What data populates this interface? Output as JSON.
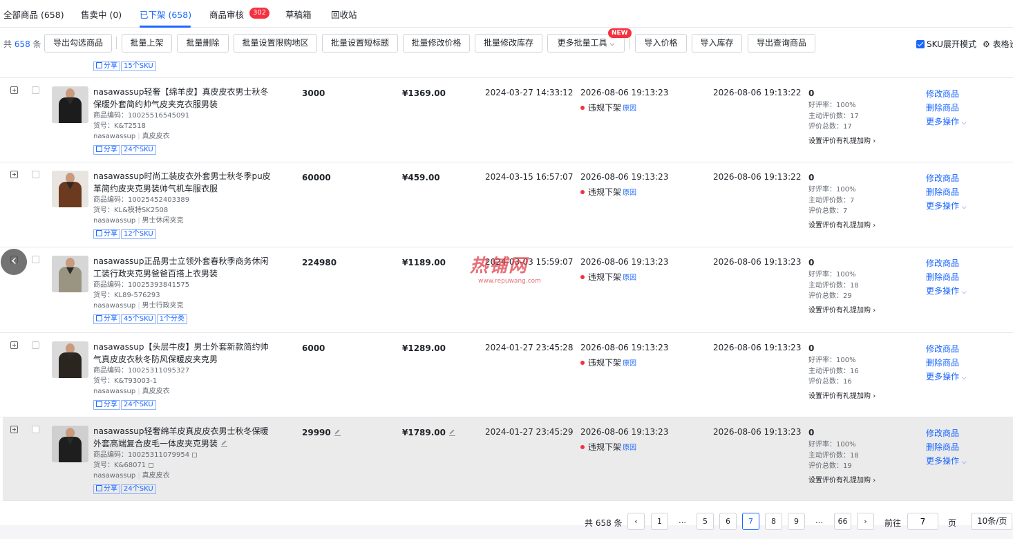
{
  "tabs": [
    {
      "label": "全部商品 (658)"
    },
    {
      "label": "售卖中 (0)"
    },
    {
      "label": "已下架 (658)"
    },
    {
      "label": "商品审核"
    },
    {
      "label": "草稿箱"
    },
    {
      "label": "回收站"
    }
  ],
  "audit_badge": "302",
  "toolbar": {
    "total_prefix": "共 ",
    "total_num": "658",
    "total_suffix": " 条",
    "buttons": [
      "导出勾选商品",
      "批量上架",
      "批量删除",
      "批量设置限购地区",
      "批量设置短标题",
      "批量修改价格",
      "批量修改库存",
      "更多批量工具",
      "导入价格",
      "导入库存",
      "导出查询商品"
    ],
    "new_badge": "NEW",
    "sku_mode": "SKU展开模式",
    "table_settings": "表格设置"
  },
  "top_partial": {
    "share": "分享",
    "sku": "15个SKU"
  },
  "rows": [
    {
      "title": "nasawassup轻奢【绵羊皮】真皮皮衣男士秋冬保暖外套简约帅气皮夹克衣服男装",
      "code": "商品编码：10025516545091",
      "sku_no": "货号：K&T2518",
      "shop": "nasawassup",
      "category": "真皮皮衣",
      "tags": [
        "分享",
        "24个SKU"
      ],
      "stock": "3000",
      "price": "¥1369.00",
      "created": "2024-03-27 14:33:12",
      "offshelf": "2026-08-06 19:13:23",
      "status": "违规下架",
      "reason": "原因",
      "updated": "2026-08-06 19:13:22",
      "review_count": "0",
      "good_rate": "好评率：100%",
      "active_reviews": "主动评价数：17",
      "total_reviews": "评价总数：17",
      "review_setting": "设置评价有礼提加购",
      "actions": [
        "修改商品",
        "删除商品",
        "更多操作"
      ]
    },
    {
      "title": "nasawassup时尚工装皮衣外套男士秋冬季pu皮革简约皮夹克男装帅气机车服衣服",
      "code": "商品编码：10025452403389",
      "sku_no": "货号：KL&模特SK2508",
      "shop": "nasawassup",
      "category": "男士休闲夹克",
      "tags": [
        "分享",
        "12个SKU"
      ],
      "stock": "60000",
      "price": "¥459.00",
      "created": "2024-03-15 16:57:07",
      "offshelf": "2026-08-06 19:13:23",
      "status": "违规下架",
      "reason": "原因",
      "updated": "2026-08-06 19:13:22",
      "review_count": "0",
      "good_rate": "好评率：100%",
      "active_reviews": "主动评价数：7",
      "total_reviews": "评价总数：7",
      "review_setting": "设置评价有礼提加购",
      "actions": [
        "修改商品",
        "删除商品",
        "更多操作"
      ]
    },
    {
      "title": "nasawassup正品男士立领外套春秋季商务休闲工装行政夹克男爸爸百搭上衣男装",
      "code": "商品编码：10025393841575",
      "sku_no": "货号：KL89-576293",
      "shop": "nasawassup",
      "category": "男士行政夹克",
      "tags": [
        "分享",
        "45个SKU",
        "1个分类"
      ],
      "stock": "224980",
      "price": "¥1189.00",
      "created": "2024-03-03 15:59:07",
      "offshelf": "2026-08-06 19:13:23",
      "status": "违规下架",
      "reason": "原因",
      "updated": "2026-08-06 19:13:23",
      "review_count": "0",
      "good_rate": "好评率：100%",
      "active_reviews": "主动评价数：18",
      "total_reviews": "评价总数：29",
      "review_setting": "设置评价有礼提加购",
      "actions": [
        "修改商品",
        "删除商品",
        "更多操作"
      ]
    },
    {
      "title": "nasawassup【头层牛皮】男士外套新款简约帅气真皮皮衣秋冬防风保暖皮夹克男",
      "code": "商品编码：10025311095327",
      "sku_no": "货号：K&T93003-1",
      "shop": "nasawassup",
      "category": "真皮皮衣",
      "tags": [
        "分享",
        "24个SKU"
      ],
      "stock": "6000",
      "price": "¥1289.00",
      "created": "2024-01-27 23:45:28",
      "offshelf": "2026-08-06 19:13:23",
      "status": "违规下架",
      "reason": "原因",
      "updated": "2026-08-06 19:13:23",
      "review_count": "0",
      "good_rate": "好评率：100%",
      "active_reviews": "主动评价数：16",
      "total_reviews": "评价总数：16",
      "review_setting": "设置评价有礼提加购",
      "actions": [
        "修改商品",
        "删除商品",
        "更多操作"
      ]
    },
    {
      "title": "nasawassup轻奢绵羊皮真皮皮衣男士秋冬保暖外套高端复合皮毛一体皮夹克男装",
      "code": "商品编码：10025311079954",
      "sku_no": "货号：K&68071",
      "shop": "nasawassup",
      "category": "真皮皮衣",
      "tags": [
        "分享",
        "24个SKU"
      ],
      "stock": "29990",
      "price": "¥1789.00",
      "created": "2024-01-27 23:45:29",
      "offshelf": "2026-08-06 19:13:23",
      "status": "违规下架",
      "reason": "原因",
      "updated": "2026-08-06 19:13:23",
      "review_count": "0",
      "good_rate": "好评率：100%",
      "active_reviews": "主动评价数：18",
      "total_reviews": "评价总数：19",
      "review_setting": "设置评价有礼提加购",
      "actions": [
        "修改商品",
        "删除商品",
        "更多操作"
      ]
    }
  ],
  "pagination": {
    "total": "共 658 条",
    "pages": [
      "1",
      "…",
      "5",
      "6",
      "7",
      "8",
      "9",
      "…",
      "66"
    ],
    "current": "7",
    "goto_label": "前往",
    "goto_value": "7",
    "page_unit": "页",
    "page_size": "10条/页"
  },
  "watermark": {
    "main": "热铺网",
    "sub": "www.repuwang.com"
  },
  "colors": {
    "accent": "#1966ff",
    "danger": "#f5303f",
    "highlight_row": "#ebebeb"
  },
  "icons": [
    "plus-square-icon",
    "share-icon",
    "edit-icon",
    "copy-icon",
    "chevron-down-icon",
    "chevron-right-icon",
    "chevron-left-icon",
    "gear-icon"
  ]
}
